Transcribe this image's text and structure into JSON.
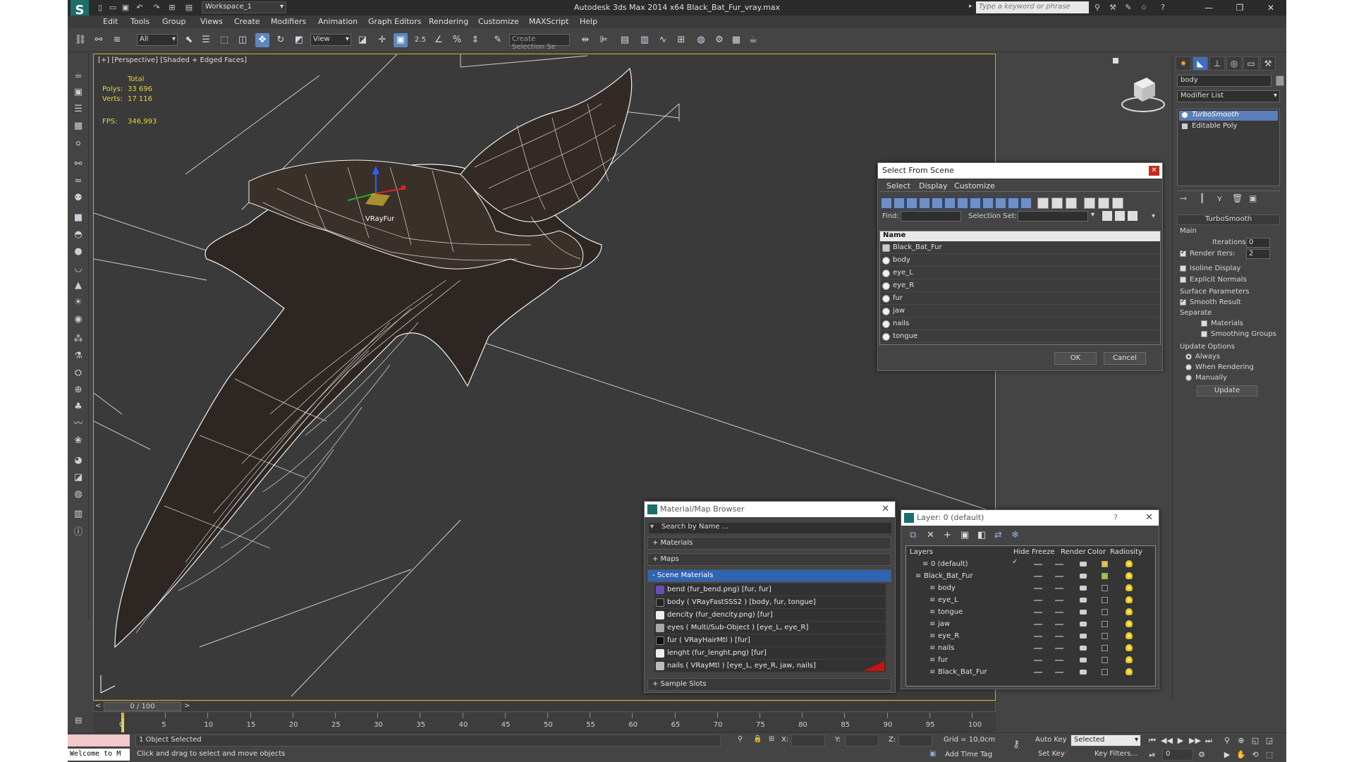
{
  "app": {
    "title": "Autodesk 3ds Max  2014 x64     Black_Bat_Fur_vray.max",
    "workspace": "Workspace_1",
    "search_placeholder": "Type a keyword or phrase"
  },
  "menu": [
    "Edit",
    "Tools",
    "Group",
    "Views",
    "Create",
    "Modifiers",
    "Animation",
    "Graph Editors",
    "Rendering",
    "Customize",
    "MAXScript",
    "Help"
  ],
  "toolbar": {
    "filter": "All",
    "refcoord": "View",
    "snap_label": "2.5",
    "selection_set_placeholder": "Create Selection Se"
  },
  "viewport": {
    "label": "[+] [Perspective] [Shaded + Edged Faces]",
    "stats": {
      "total_label": "Total",
      "polys_label": "Polys:",
      "polys": "33 696",
      "verts_label": "Verts:",
      "verts": "17 116",
      "fps_label": "FPS:",
      "fps": "346,993"
    },
    "vrayfur_label": "VRayFur"
  },
  "command_panel": {
    "object_name": "body",
    "modifier_list": "Modifier List",
    "stack": [
      "TurboSmooth",
      "Editable Poly"
    ],
    "rollout_title": "TurboSmooth",
    "main_label": "Main",
    "iterations_label": "Iterations:",
    "iterations": "0",
    "render_iters_label": "Render Iters:",
    "render_iters": "2",
    "isoline": "Isoline Display",
    "explicit": "Explicit Normals",
    "surface_params": "Surface Parameters",
    "smooth_result": "Smooth Result",
    "separate": "Separate",
    "materials": "Materials",
    "smoothing_groups": "Smoothing Groups",
    "update_options": "Update Options",
    "always": "Always",
    "when_rendering": "When Rendering",
    "manually": "Manually",
    "update_btn": "Update"
  },
  "select_from_scene": {
    "title": "Select From Scene",
    "menus": [
      "Select",
      "Display",
      "Customize"
    ],
    "find_label": "Find:",
    "selection_set_label": "Selection Set:",
    "column": "Name",
    "items": [
      "Black_Bat_Fur",
      "body",
      "eye_L",
      "eye_R",
      "fur",
      "jaw",
      "nails",
      "tongue"
    ],
    "ok": "OK",
    "cancel": "Cancel"
  },
  "material_browser": {
    "title": "Material/Map Browser",
    "search": "Search by Name ...",
    "sections": [
      "+ Materials",
      "+ Maps",
      "- Scene Materials"
    ],
    "items": [
      "bend (fur_bend.png)  [fur, fur]",
      "body  ( VRayFastSSS2 )  [body, fur, tongue]",
      "dencity (fur_dencity.png)  [fur]",
      "eyes  ( Multi/Sub-Object )  [eye_L, eye_R]",
      "fur  ( VRayHairMtl )  [fur]",
      "lenght (fur_lenght.png)  [fur]",
      "nails  ( VRayMtl )  [eye_L, eye_R, jaw, nails]"
    ],
    "sample_slots": "+ Sample Slots"
  },
  "layers": {
    "title": "Layer: 0 (default)",
    "help": "?",
    "columns": [
      "Layers",
      "Hide",
      "Freeze",
      "Render",
      "Color",
      "Radiosity"
    ],
    "rows": [
      {
        "name": "0 (default)",
        "indent": 1,
        "color": "#e8c23a"
      },
      {
        "name": "Black_Bat_Fur",
        "indent": 0,
        "color": "#9dc83a"
      },
      {
        "name": "body",
        "indent": 2,
        "color": "#333333"
      },
      {
        "name": "eye_L",
        "indent": 2,
        "color": "#333333"
      },
      {
        "name": "tongue",
        "indent": 2,
        "color": "#333333"
      },
      {
        "name": "jaw",
        "indent": 2,
        "color": "#333333"
      },
      {
        "name": "eye_R",
        "indent": 2,
        "color": "#333333"
      },
      {
        "name": "nails",
        "indent": 2,
        "color": "#333333"
      },
      {
        "name": "fur",
        "indent": 2,
        "color": "#333333"
      },
      {
        "name": "Black_Bat_Fur",
        "indent": 2,
        "color": "#333333"
      }
    ]
  },
  "timeline": {
    "frame": "0 / 100",
    "ticks": [
      "0",
      "5",
      "10",
      "15",
      "20",
      "25",
      "30",
      "35",
      "40",
      "45",
      "50",
      "55",
      "60",
      "65",
      "70",
      "75",
      "80",
      "85",
      "90",
      "95",
      "100"
    ]
  },
  "status": {
    "maxscript": "Welcome to M",
    "selected": "1 Object Selected",
    "prompt": "Click and drag to select and move objects",
    "x_label": "X:",
    "y_label": "Y:",
    "z_label": "Z:",
    "grid": "Grid = 10,0cm",
    "add_time_tag": "Add Time Tag",
    "auto_key": "Auto Key",
    "set_key": "Set Key",
    "selected_dropdown": "Selected",
    "key_filters": "Key Filters...",
    "frame_field": "0"
  }
}
